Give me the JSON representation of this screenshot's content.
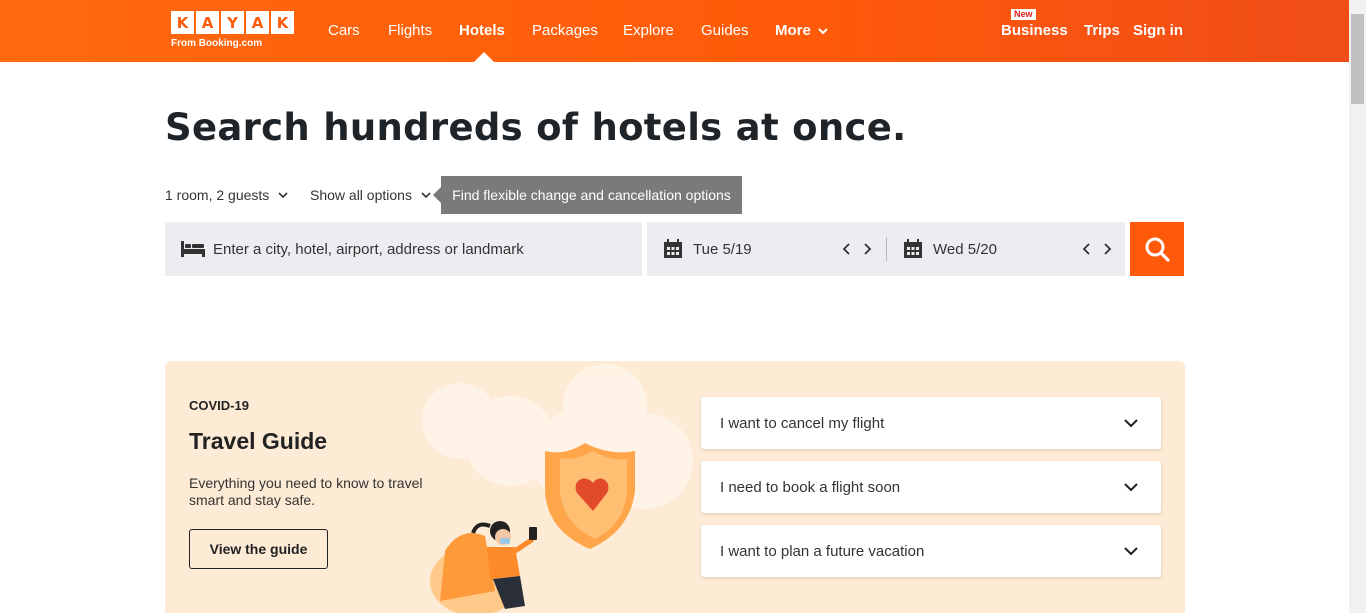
{
  "header": {
    "logo_letters": [
      "K",
      "A",
      "Y",
      "A",
      "K"
    ],
    "logo_sub": "From Booking.com",
    "nav": {
      "cars": "Cars",
      "flights": "Flights",
      "hotels": "Hotels",
      "packages": "Packages",
      "explore": "Explore",
      "guides": "Guides",
      "more": "More"
    },
    "business_badge": "New",
    "business": "Business",
    "trips": "Trips",
    "sign_in": "Sign in",
    "active_tab": "Hotels"
  },
  "main": {
    "title": "Search hundreds of hotels at once.",
    "guests_option": "1 room, 2 guests",
    "all_options": "Show all options",
    "tooltip": "Find flexible change and cancellation options"
  },
  "search": {
    "destination_placeholder": "Enter a city, hotel, airport, address or landmark",
    "checkin": "Tue 5/19",
    "checkout": "Wed 5/20"
  },
  "covid": {
    "tag": "COVID-19",
    "title": "Travel Guide",
    "description": "Everything you need to know to travel smart and stay safe.",
    "button": "View the guide",
    "accordion": [
      {
        "label": "I want to cancel my flight"
      },
      {
        "label": "I need to book a flight soon"
      },
      {
        "label": "I want to plan a future vacation"
      }
    ]
  },
  "colors": {
    "brand": "#ff5a0a",
    "card_bg": "#fdebd6",
    "tooltip_bg": "#7a7a7a",
    "field_bg": "#ebedf0"
  },
  "icons": {
    "bed": "bed-icon",
    "calendar": "calendar-icon",
    "search": "search-icon",
    "chevron": "chevron-down-icon"
  }
}
